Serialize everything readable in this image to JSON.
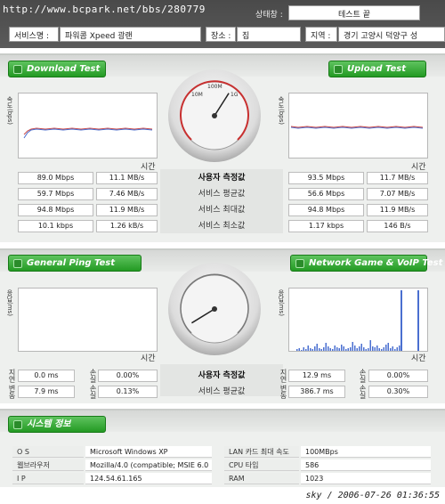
{
  "header": {
    "url": "http://www.bcpark.net/bbs/280779",
    "status_label": "상태창 :",
    "status_value": "테스트 끝",
    "service_label": "서비스명 :",
    "service_value": "파워콤 Xpeed 광랜",
    "place_label": "장소 :",
    "place_value": "집",
    "region_label": "지역 :",
    "region_value": "경기 고양시 덕양구 성"
  },
  "speed": {
    "download_title": "Download Test",
    "upload_title": "Upload Test",
    "ylabel": "속도(bps)",
    "xlabel": "시간",
    "gauge_labels": [
      "10M",
      "100M",
      "1G"
    ],
    "gauge_needle_fraction": 0.62,
    "rows": [
      {
        "label": "사용자 측정값",
        "dl_bps": "89.0 Mbps",
        "dl_Bs": "11.1 MB/s",
        "ul_bps": "93.5 Mbps",
        "ul_Bs": "11.7 MB/s",
        "bold": true
      },
      {
        "label": "서비스 평균값",
        "dl_bps": "59.7 Mbps",
        "dl_Bs": "7.46 MB/s",
        "ul_bps": "56.6 Mbps",
        "ul_Bs": "7.07 MB/s",
        "bold": false
      },
      {
        "label": "서비스 최대값",
        "dl_bps": "94.8 Mbps",
        "dl_Bs": "11.9 MB/s",
        "ul_bps": "94.8 Mbps",
        "ul_Bs": "11.9 MB/s",
        "bold": false
      },
      {
        "label": "서비스 최소값",
        "dl_bps": "10.1 kbps",
        "dl_Bs": "1.26 kB/s",
        "ul_bps": "1.17 kbps",
        "ul_Bs": "146 B/s",
        "bold": false
      }
    ]
  },
  "ping": {
    "ping_title": "General Ping Test",
    "game_title": "Network Game & VoIP Test",
    "ylabel": "응답(ms)",
    "xlabel": "시간",
    "gauge_needle_fraction": 0.05,
    "row_labels": [
      "사용자 측정값",
      "서비스 평균값"
    ],
    "left_side_labels": [
      "지연",
      "변동"
    ],
    "loss_side_label": "손실",
    "rows": [
      {
        "ping_ms": "0.0 ms",
        "ping_loss": "0.00%",
        "game_ms": "12.9 ms",
        "game_loss": "0.00%"
      },
      {
        "ping_ms": "7.9 ms",
        "ping_loss": "0.13%",
        "game_ms": "386.7 ms",
        "game_loss": "0.30%"
      }
    ]
  },
  "system": {
    "title": "시스템 정보",
    "left": [
      {
        "key": "O S",
        "value": "Microsoft Windows XP"
      },
      {
        "key": "웹브라우저",
        "value": "Mozilla/4.0 (compatible; MSIE 6.0"
      },
      {
        "key": "I P",
        "value": "124.54.61.165"
      }
    ],
    "right": [
      {
        "key": "LAN 카드 최대 속도",
        "value": "100MBps"
      },
      {
        "key": "CPU 타입",
        "value": "586"
      },
      {
        "key": "RAM",
        "value": "1023"
      }
    ]
  },
  "footer": "sky / 2006-07-26 01:36:55",
  "colors": {
    "accent_green": "#2ea52e",
    "chart_blue": "#4a6fd0",
    "chart_red": "#c84a4a"
  }
}
